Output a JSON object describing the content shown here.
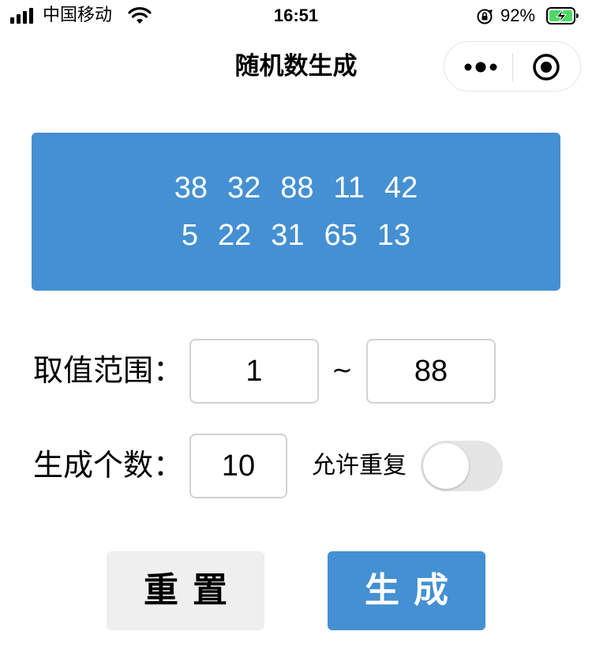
{
  "status_bar": {
    "carrier": "中国移动",
    "time": "16:51",
    "battery": "92%"
  },
  "nav": {
    "title": "随机数生成",
    "more_icon": "more-dots-icon",
    "close_icon": "target-circle-icon"
  },
  "results": {
    "row1": [
      "38",
      "32",
      "88",
      "11",
      "42"
    ],
    "row2": [
      "5",
      "22",
      "31",
      "65",
      "13"
    ]
  },
  "form": {
    "range_label": "取值范围：",
    "range_min": "1",
    "range_separator": "~",
    "range_max": "88",
    "count_label": "生成个数：",
    "count_value": "10",
    "allow_repeat_label": "允许重复",
    "allow_repeat_on": false
  },
  "buttons": {
    "reset": "重置",
    "generate": "生成"
  },
  "colors": {
    "accent": "#4490d2",
    "toggle_off": "#e5e5e5",
    "reset_bg": "#efefef",
    "battery_charge": "#4cd964"
  }
}
